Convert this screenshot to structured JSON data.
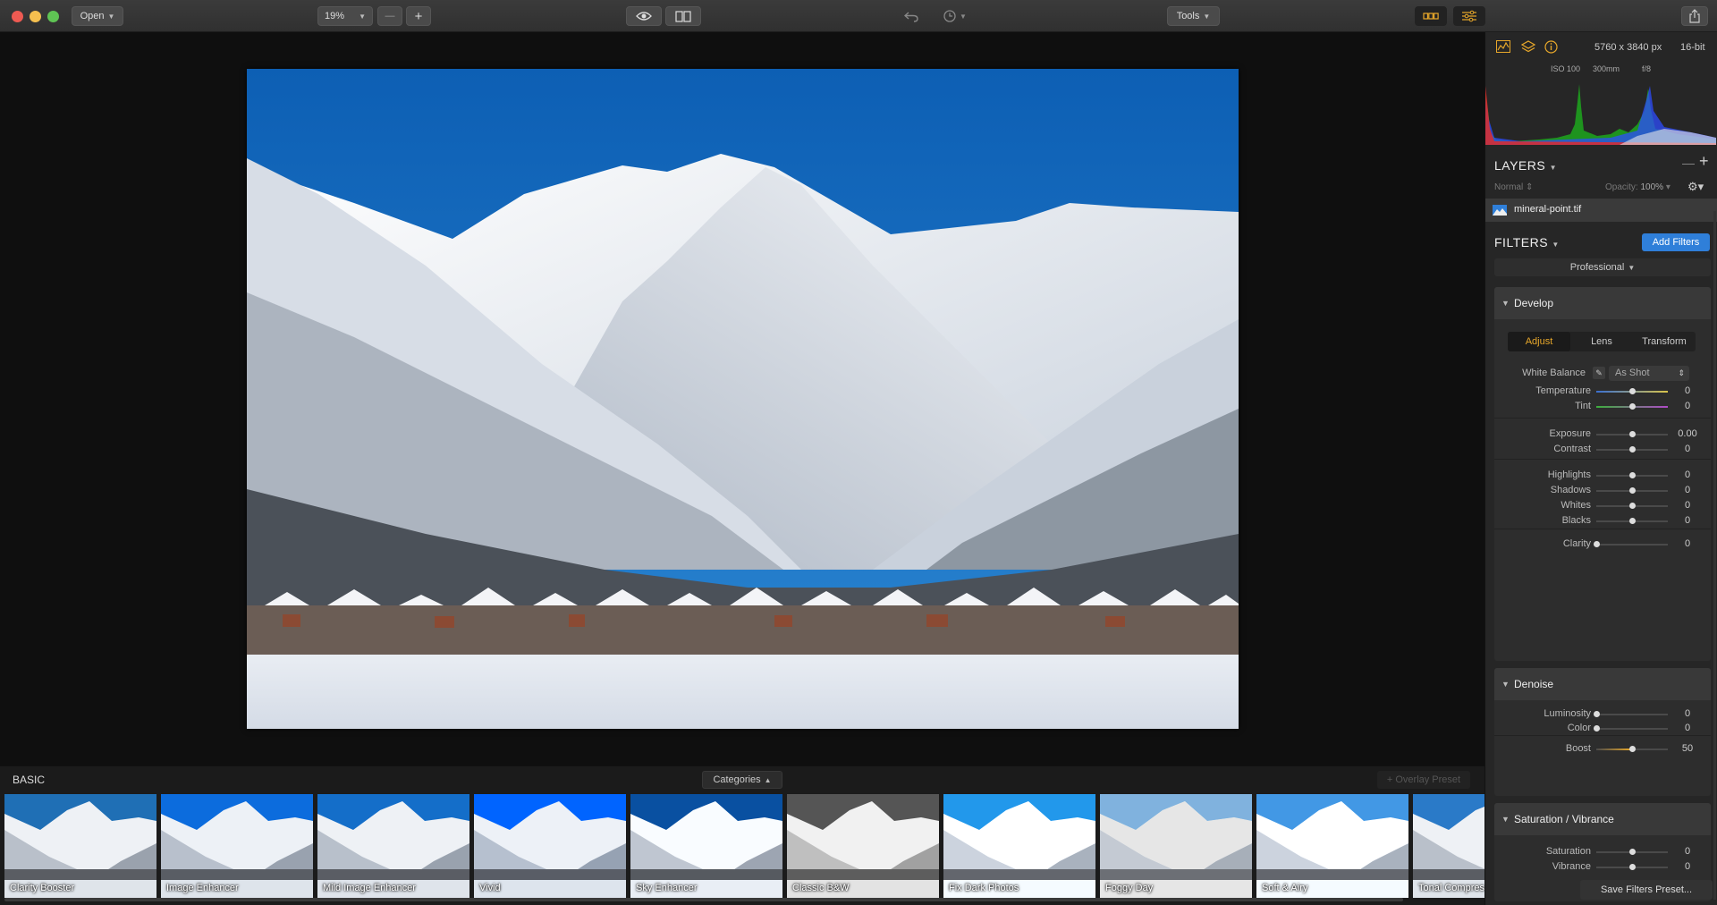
{
  "toolbar": {
    "open_label": "Open",
    "zoom_value": "19%",
    "zoom_out": "—",
    "zoom_in": "+",
    "tools_label": "Tools"
  },
  "colors": {
    "accent": "#e8a82a",
    "primary_button": "#2f7fd9",
    "close": "#ee5a52",
    "minimize": "#f5bf4f",
    "maximize": "#5fc454"
  },
  "info": {
    "dimensions": "5760 x 3840 px",
    "bit_depth": "16-bit",
    "iso": "ISO 100",
    "focal": "300mm",
    "aperture": "f/8"
  },
  "layers": {
    "title": "LAYERS",
    "blend_mode": "Normal",
    "opacity_label": "Opacity:",
    "opacity_value": "100%",
    "layer_name": "mineral-point.tif"
  },
  "filters": {
    "title": "FILTERS",
    "add_button": "Add Filters",
    "preset_mode": "Professional",
    "save_preset": "Save Filters Preset..."
  },
  "develop": {
    "title": "Develop",
    "tabs": [
      "Adjust",
      "Lens",
      "Transform"
    ],
    "active_tab": 0,
    "white_balance_label": "White Balance",
    "white_balance_value": "As Shot",
    "sliders": [
      {
        "label": "Temperature",
        "value": "0",
        "pos": 0.5
      },
      {
        "label": "Tint",
        "value": "0",
        "pos": 0.5
      },
      {
        "label": "Exposure",
        "value": "0.00",
        "pos": 0.5
      },
      {
        "label": "Contrast",
        "value": "0",
        "pos": 0.5
      },
      {
        "label": "Highlights",
        "value": "0",
        "pos": 0.5
      },
      {
        "label": "Shadows",
        "value": "0",
        "pos": 0.5
      },
      {
        "label": "Whites",
        "value": "0",
        "pos": 0.5
      },
      {
        "label": "Blacks",
        "value": "0",
        "pos": 0.5
      },
      {
        "label": "Clarity",
        "value": "0",
        "pos": 0.0
      }
    ]
  },
  "denoise": {
    "title": "Denoise",
    "sliders": [
      {
        "label": "Luminosity",
        "value": "0",
        "pos": 0.0
      },
      {
        "label": "Color",
        "value": "0",
        "pos": 0.0
      },
      {
        "label": "Boost",
        "value": "50",
        "pos": 0.5
      }
    ]
  },
  "satvib": {
    "title": "Saturation / Vibrance",
    "sliders": [
      {
        "label": "Saturation",
        "value": "0",
        "pos": 0.5
      },
      {
        "label": "Vibrance",
        "value": "0",
        "pos": 0.5
      }
    ]
  },
  "presets": {
    "category_label": "BASIC",
    "categories_button": "Categories",
    "overlay_button": "+ Overlay Preset",
    "items": [
      {
        "label": "Clarity Booster",
        "sky": "#1f6fb5",
        "filter": "none"
      },
      {
        "label": "Image Enhancer",
        "sky": "#1a6ac8",
        "filter": "saturate(1.2)"
      },
      {
        "label": "Mild Image Enhancer",
        "sky": "#1b6dc0",
        "filter": "saturate(1.1)"
      },
      {
        "label": "Vivid",
        "sky": "#1560d0",
        "filter": "saturate(1.5)"
      },
      {
        "label": "Sky Enhancer",
        "sky": "#14549e",
        "filter": "contrast(1.1)"
      },
      {
        "label": "Classic B&W",
        "sky": "#555555",
        "filter": "grayscale(1)"
      },
      {
        "label": "Fix Dark Photos",
        "sky": "#1f8ad6",
        "filter": "brightness(1.1)"
      },
      {
        "label": "Foggy Day",
        "sky": "#6fa6d6",
        "filter": "brightness(1.15) contrast(0.8)"
      },
      {
        "label": "Soft & Airy",
        "sky": "#3c8ad0",
        "filter": "brightness(1.1)"
      },
      {
        "label": "Tonal Compres",
        "sky": "#2a7ac8",
        "filter": "none"
      }
    ]
  }
}
